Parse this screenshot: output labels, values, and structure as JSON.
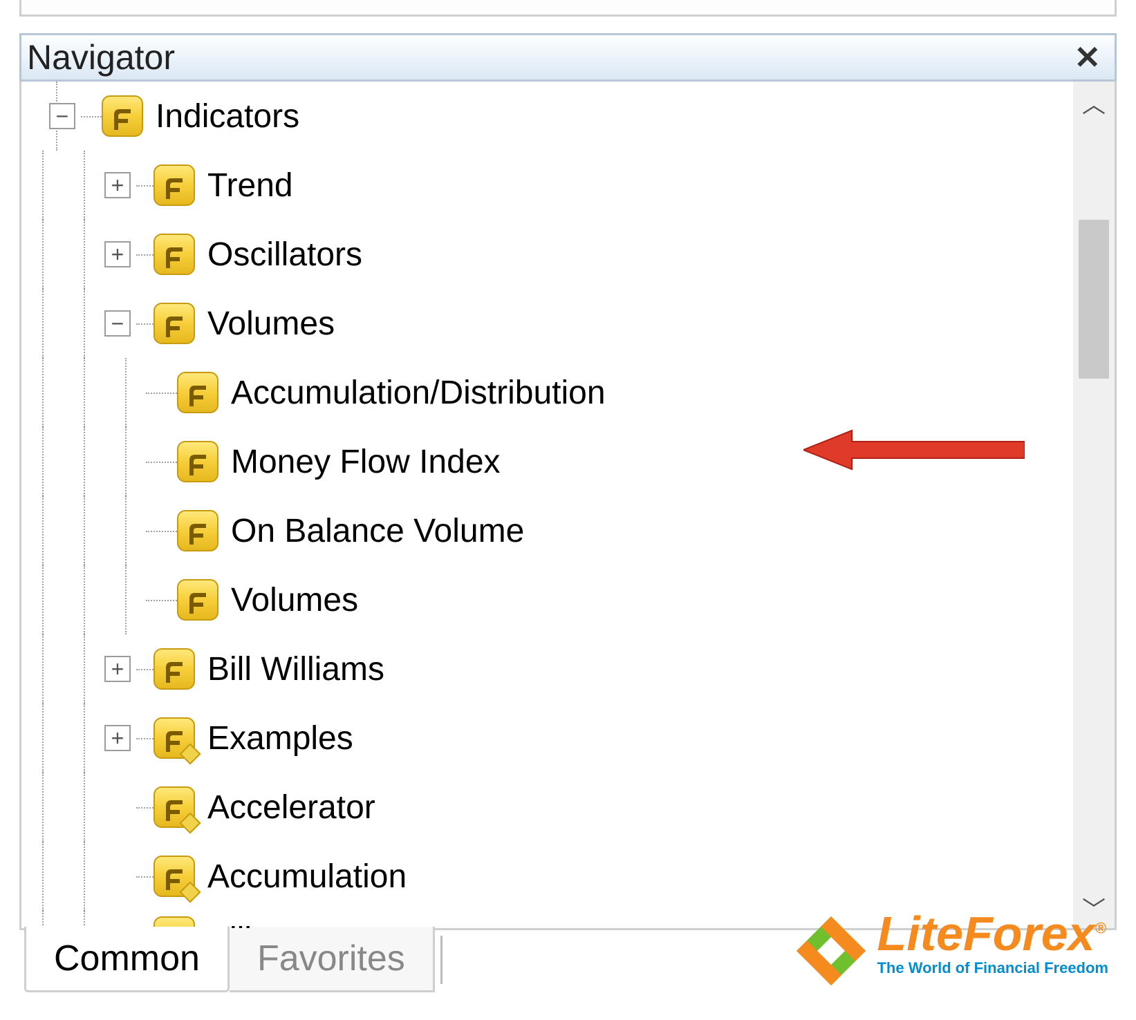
{
  "panel": {
    "title": "Navigator"
  },
  "tree": {
    "root": {
      "label": "Indicators",
      "children": [
        {
          "label": "Trend"
        },
        {
          "label": "Oscillators"
        },
        {
          "label": "Volumes",
          "children": [
            {
              "label": "Accumulation/Distribution"
            },
            {
              "label": "Money Flow Index"
            },
            {
              "label": "On Balance Volume"
            },
            {
              "label": "Volumes"
            }
          ]
        },
        {
          "label": "Bill Williams"
        },
        {
          "label": "Examples"
        },
        {
          "label": "Accelerator"
        },
        {
          "label": "Accumulation"
        },
        {
          "label": "Alligator"
        }
      ]
    }
  },
  "tabs": {
    "active": "Common",
    "inactive": "Favorites"
  },
  "logo": {
    "brand_a": "Lite",
    "brand_b": "Forex",
    "reg": "®",
    "tagline": "The World of Financial Freedom"
  }
}
